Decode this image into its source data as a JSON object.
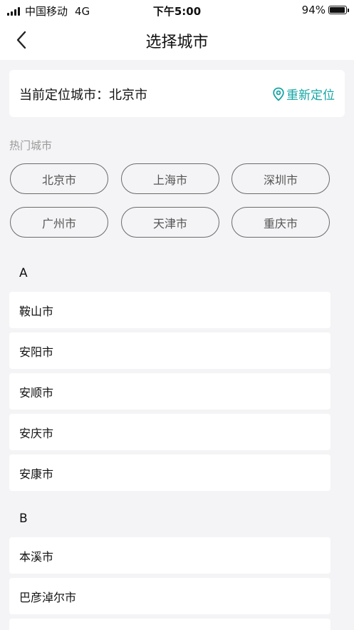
{
  "status_bar": {
    "carrier": "中国移动",
    "network": "4G",
    "time": "下午5:00",
    "battery_text": "94%",
    "battery_level": 0.94
  },
  "nav": {
    "title": "选择城市"
  },
  "current_location": {
    "label": "当前定位城市：北京市",
    "relocate_label": "重新定位",
    "accent_color": "#16a5a5"
  },
  "hot_cities": {
    "title": "热门城市",
    "items": [
      "北京市",
      "上海市",
      "深圳市",
      "广州市",
      "天津市",
      "重庆市"
    ]
  },
  "sections": [
    {
      "letter": "A",
      "cities": [
        "鞍山市",
        "安阳市",
        "安顺市",
        "安庆市",
        "安康市"
      ]
    },
    {
      "letter": "B",
      "cities": [
        "本溪市",
        "巴彦淖尔市"
      ]
    }
  ]
}
